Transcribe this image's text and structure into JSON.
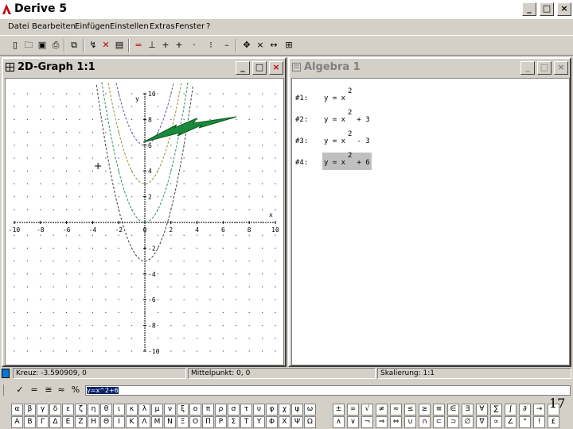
{
  "app": {
    "title": "Derive 5"
  },
  "window_buttons": {
    "minimize": "_",
    "maximize": "□",
    "close": "×"
  },
  "menu": [
    "Datei",
    "Bearbeiten",
    "Einfügen",
    "Einstellen",
    "Extras",
    "Fenster",
    "?"
  ],
  "toolbar_icons": [
    "new-icon",
    "open-icon",
    "save-icon",
    "print-icon",
    "copy-icon",
    "author-icon",
    "delete-icon",
    "insert-text-icon",
    "simplify-icon",
    "approximate-icon",
    "solve-icon",
    "substitute-icon",
    "limit-icon",
    "derivative-icon",
    "integral-icon",
    "sum-icon",
    "product-icon",
    "graph-2d-icon",
    "graph-3d-icon",
    "plot-icon",
    "window-icon"
  ],
  "graph_window": {
    "title": "2D-Graph 1:1",
    "axis_labels": {
      "x": "x",
      "y": "y"
    },
    "x_ticks": [
      "-10",
      "-8",
      "-6",
      "-4",
      "-2",
      "0",
      "2",
      "4",
      "6",
      "8",
      "10"
    ],
    "y_ticks": [
      "10",
      "8",
      "6",
      "4",
      "2",
      "-2",
      "-4",
      "-6",
      "-8",
      "-10"
    ],
    "x_range": [
      -10,
      10
    ],
    "y_range": [
      -10,
      10
    ]
  },
  "chart_data": {
    "type": "line",
    "xlabel": "x",
    "ylabel": "y",
    "xlim": [
      -10,
      10
    ],
    "ylim": [
      -10,
      10
    ],
    "grid": true,
    "series": [
      {
        "name": "y = x^2",
        "offset": 0,
        "color": "#2e8b57"
      },
      {
        "name": "y = x^2 + 3",
        "offset": 3,
        "color": "#9b8b2e"
      },
      {
        "name": "y = x^2 - 3",
        "offset": -3,
        "color": "#404040"
      },
      {
        "name": "y = x^2 + 6",
        "offset": 6,
        "color": "#6a4c9c"
      }
    ]
  },
  "algebra_window": {
    "title": "Algebra 1",
    "expressions": [
      {
        "label": "#1:",
        "lhs": "y = x",
        "exp": "2",
        "rest": ""
      },
      {
        "label": "#2:",
        "lhs": "y = x",
        "exp": "2",
        "rest": " + 3"
      },
      {
        "label": "#3:",
        "lhs": "y = x",
        "exp": "2",
        "rest": " - 3"
      },
      {
        "label": "#4:",
        "lhs": "y = x",
        "exp": "2",
        "rest": " + 6"
      }
    ]
  },
  "status": {
    "cross": "Kreuz: -3.590909, 0",
    "center": "Mittelpunkt: 0, 0",
    "scale": "Skalierung: 1:1"
  },
  "entry": {
    "value": "y=x^2+6"
  },
  "greek_row1": [
    "α",
    "β",
    "γ",
    "δ",
    "ε",
    "ζ",
    "η",
    "θ",
    "ι",
    "κ",
    "λ",
    "μ",
    "ν",
    "ξ",
    "ο",
    "π",
    "ρ",
    "σ",
    "τ",
    "υ",
    "φ",
    "χ",
    "ψ",
    "ω"
  ],
  "greek_row2": [
    "Α",
    "Β",
    "Γ",
    "Δ",
    "Ε",
    "Ζ",
    "Η",
    "Θ",
    "Ι",
    "Κ",
    "Λ",
    "Μ",
    "Ν",
    "Ξ",
    "Ο",
    "Π",
    "Ρ",
    "Σ",
    "Τ",
    "Υ",
    "Φ",
    "Χ",
    "Ψ",
    "Ω"
  ],
  "math_row1": [
    "±",
    "∞",
    "√",
    "≠",
    "≈",
    "≤",
    "≥",
    "≡",
    "∈",
    "∃",
    "∀",
    "∑",
    "∫",
    "∂",
    "→",
    "'"
  ],
  "math_row2": [
    "∧",
    "∨",
    "¬",
    "⇒",
    "⇔",
    "∪",
    "∩",
    "⊂",
    "⊃",
    "∅",
    "∇",
    "∝",
    "∠",
    "°",
    "!",
    "£"
  ],
  "slide_number": "17"
}
